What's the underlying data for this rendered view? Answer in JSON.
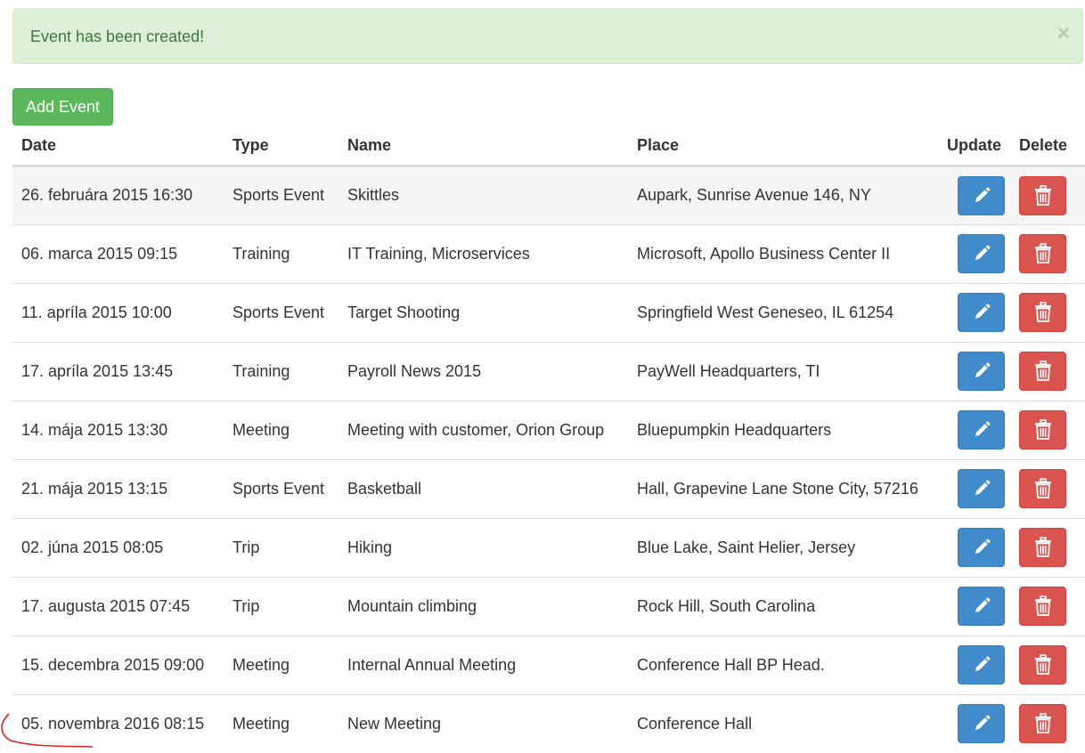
{
  "alert": {
    "message": "Event has been created!",
    "close_symbol": "×"
  },
  "toolbar": {
    "add_label": "Add Event"
  },
  "table": {
    "headers": {
      "date": "Date",
      "type": "Type",
      "name": "Name",
      "place": "Place",
      "update": "Update",
      "delete": "Delete"
    },
    "rows": [
      {
        "date": "26. februára 2015 16:30",
        "type": "Sports Event",
        "name": "Skittles",
        "place": "Aupark, Sunrise Avenue 146, NY"
      },
      {
        "date": "06. marca 2015 09:15",
        "type": "Training",
        "name": "IT Training, Microservices",
        "place": "Microsoft, Apollo Business Center II"
      },
      {
        "date": "11. apríla 2015 10:00",
        "type": "Sports Event",
        "name": "Target Shooting",
        "place": "Springfield West Geneseo, IL 61254"
      },
      {
        "date": "17. apríla 2015 13:45",
        "type": "Training",
        "name": "Payroll News 2015",
        "place": "PayWell Headquarters, TI"
      },
      {
        "date": "14. mája 2015 13:30",
        "type": "Meeting",
        "name": "Meeting with customer, Orion Group",
        "place": "Bluepumpkin Headquarters"
      },
      {
        "date": "21. mája 2015 13:15",
        "type": "Sports Event",
        "name": "Basketball",
        "place": "Hall, Grapevine Lane Stone City, 57216"
      },
      {
        "date": "02. júna 2015 08:05",
        "type": "Trip",
        "name": "Hiking",
        "place": "Blue Lake, Saint Helier, Jersey"
      },
      {
        "date": "17. augusta 2015 07:45",
        "type": "Trip",
        "name": "Mountain climbing",
        "place": "Rock Hill, South Carolina"
      },
      {
        "date": "15. decembra 2015 09:00",
        "type": "Meeting",
        "name": "Internal Annual Meeting",
        "place": "Conference Hall BP Head."
      },
      {
        "date": "05. novembra 2016 08:15",
        "type": "Meeting",
        "name": "New Meeting",
        "place": "Conference Hall"
      }
    ]
  },
  "icons": {
    "update": "pencil-icon",
    "delete": "trash-icon"
  },
  "colors": {
    "success": "#5cb85c",
    "primary": "#428bca",
    "danger": "#d9534f",
    "alert_bg": "#dff0d8",
    "annotation": "#e02020"
  }
}
